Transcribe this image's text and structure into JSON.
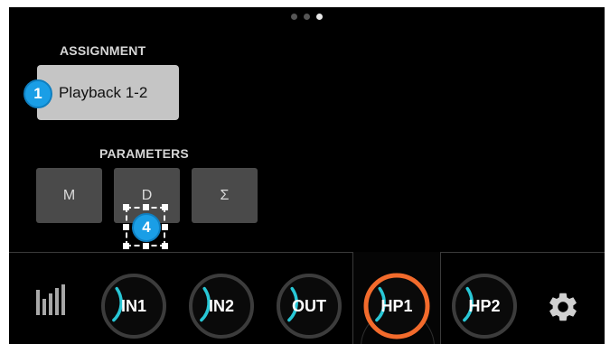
{
  "colors": {
    "accent": "#28c7d6",
    "active_ring": "#f36b2c",
    "badge": "#1a9ee6",
    "button_light": "#c5c5c5",
    "button_dark": "#4a4a4a"
  },
  "assignment": {
    "label": "ASSIGNMENT",
    "button_label": "Playback 1-2",
    "badge_number": "1"
  },
  "parameters": {
    "label": "PARAMETERS",
    "buttons": [
      "M",
      "D",
      "Σ"
    ],
    "badge_number": "4"
  },
  "bottom_bar": {
    "meters_icon": "level-meters-icon",
    "knobs": [
      {
        "label": "IN1",
        "level": 0.3,
        "active": false
      },
      {
        "label": "IN2",
        "level": 0.3,
        "active": false
      },
      {
        "label": "OUT",
        "level": 0.3,
        "active": false
      },
      {
        "label": "HP1",
        "level": 0.3,
        "active": true
      },
      {
        "label": "HP2",
        "level": 0.3,
        "active": false
      }
    ],
    "settings_icon": "gear-icon"
  },
  "page_indicator": {
    "count": 3,
    "active": 3
  }
}
